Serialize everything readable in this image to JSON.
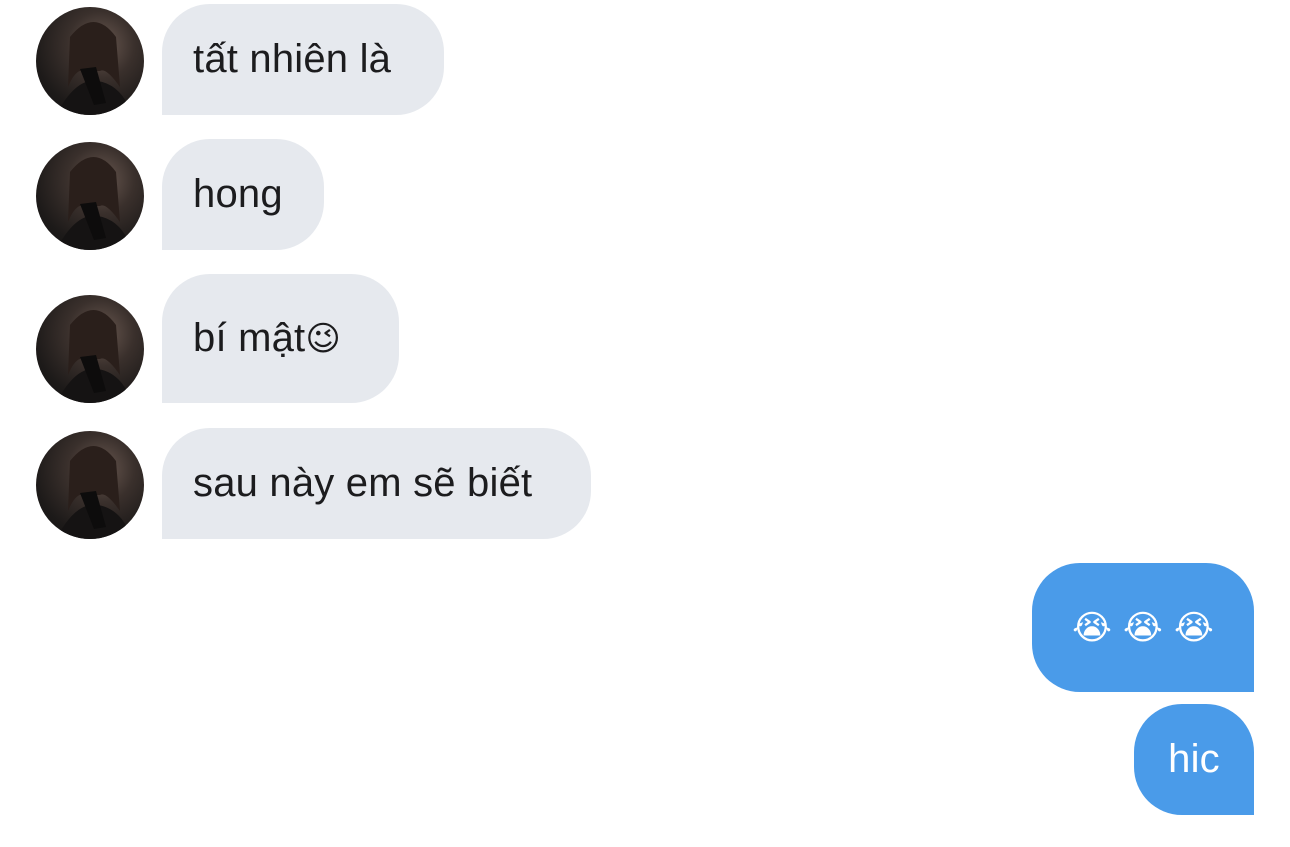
{
  "messages": [
    {
      "sender": "contact",
      "text": "tất nhiên là"
    },
    {
      "sender": "contact",
      "text": "hong"
    },
    {
      "sender": "contact",
      "text": "bí mật",
      "emoji": "😉"
    },
    {
      "sender": "contact",
      "text": "sau này em sẽ biết"
    },
    {
      "sender": "me",
      "text": "😭 😭 😭"
    },
    {
      "sender": "me",
      "text": "hic"
    }
  ],
  "colors": {
    "incoming_bubble": "#e6e9ee",
    "outgoing_bubble": "#4a9be9",
    "incoming_text": "#1c1c1e",
    "outgoing_text": "#ffffff"
  }
}
